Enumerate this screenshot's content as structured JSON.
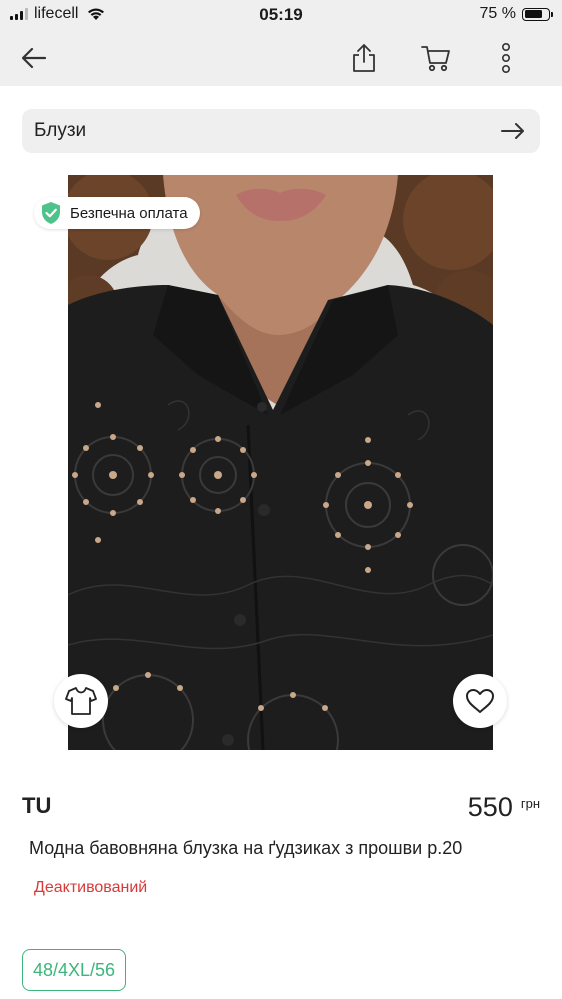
{
  "status_bar": {
    "carrier": "lifecell",
    "time": "05:19",
    "battery": "75 %",
    "battery_level": 0.75
  },
  "nav": {
    "back_icon": "arrow-left-icon",
    "share_icon": "share-icon",
    "cart_icon": "cart-icon",
    "more_icon": "more-vertical-icon"
  },
  "category_bar": {
    "label": "Блузи",
    "icon": "arrow-right-icon"
  },
  "product": {
    "badge": "Безпечна оплата",
    "brand": "TU",
    "price": "550",
    "currency": "грн",
    "title": "Модна бавовняна блузка на ґудзиках з прошви р.20",
    "status": "Деактивований",
    "size": "48/4XL/56"
  },
  "colors": {
    "accent_green": "#3db57a",
    "status_red": "#d83a3a",
    "bar_gray": "#efefef"
  }
}
